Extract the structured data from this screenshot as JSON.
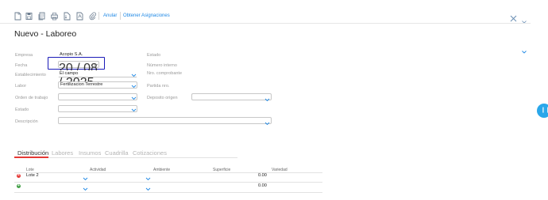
{
  "toolbar": {
    "icons": [
      "new-doc-icon",
      "save-icon",
      "copy-doc-icon",
      "print-icon",
      "export-icon",
      "pdf-icon",
      "attach-icon"
    ],
    "anular_label": "Anular",
    "obtener_label": "Obtener Asignaciones"
  },
  "page": {
    "title": "Nuevo - Laboreo"
  },
  "form": {
    "empresa_label": "Empresa",
    "empresa_value": "Acopio S.A.",
    "fecha_label": "Fecha",
    "fecha_value": "20 / 08 / 2025",
    "establecimiento_label": "Establecimiento",
    "establecimiento_value": "El campo",
    "labor_label": "Labor",
    "labor_value": "Fertilizacion Terrestre",
    "orden_label": "Orden de trabajo",
    "orden_value": "",
    "estado_left_label": "Estado",
    "estado_left_value": "",
    "descripcion_label": "Descripción",
    "descripcion_value": "",
    "estado_right_label": "Estado",
    "numero_interno_label": "Número interno",
    "nro_comprobante_label": "Nro. comprobante",
    "partida_label": "Partida nro.",
    "deposito_label": "Deposito origen",
    "deposito_value": ""
  },
  "tabs": [
    "Distribución",
    "Labores",
    "Insumos",
    "Cuadrilla",
    "Cotizaciones"
  ],
  "grid": {
    "columns": [
      "Lote",
      "Actividad",
      "Ambiente",
      "Superficie",
      "Variedad"
    ],
    "rows": [
      {
        "lote": "Lote 2",
        "superficie": "0.00"
      },
      {
        "lote": "",
        "superficie": "0.00"
      }
    ]
  },
  "colors": {
    "accent": "#1e88e5",
    "active_tab": "#e53935",
    "date_highlight": "#1a1ab8",
    "side_button": "#2aa7ea"
  }
}
